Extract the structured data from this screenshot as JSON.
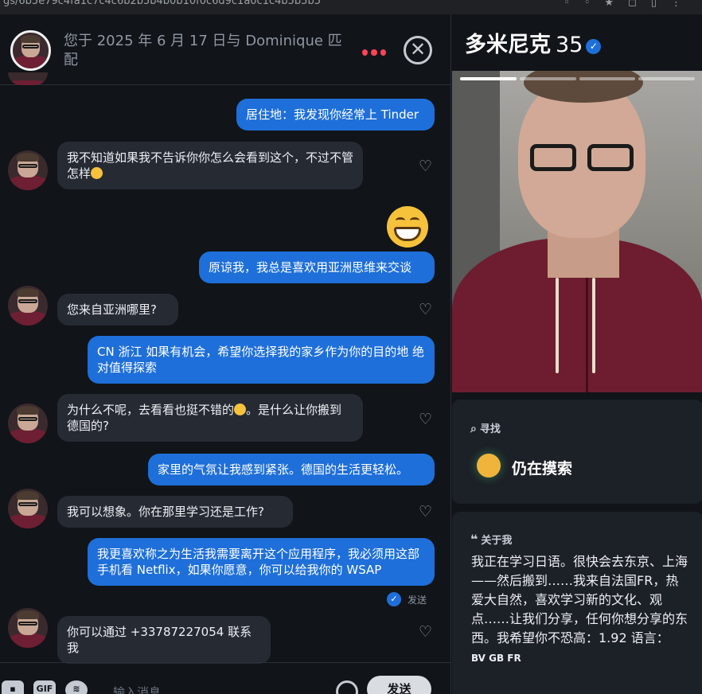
{
  "browser": {
    "url": "gs/6b5e79c4fa1c7c4c6b2b5b4b0b10f0c6d9c1a0c1c4b5b5b5",
    "icons": [
      "cast-icon",
      "translate-icon",
      "star-icon",
      "extensions-icon",
      "profile-icon",
      "menu-icon"
    ]
  },
  "chat": {
    "header": {
      "match_info": "您于 2025 年 6 月 17 日与 Dominique 匹配"
    },
    "messages": [
      {
        "dir": "out",
        "text": "居住地：我发现你经常上 Tinder"
      },
      {
        "dir": "in",
        "text": "我不知道如果我不告诉你你怎么会看到这个，不过不管怎样"
      },
      {
        "dir": "out",
        "text": "原谅我，我总是喜欢用亚洲思维来交谈"
      },
      {
        "dir": "in",
        "text": "您来自亚洲哪里?"
      },
      {
        "dir": "out",
        "text": "CN 浙江 如果有机会，希望你选择我的家乡作为你的目的地 绝对值得探索"
      },
      {
        "dir": "in",
        "text_a": "为什么不呢，去看看也挺不错的",
        "text_b": "。是什么让你搬到德国的?"
      },
      {
        "dir": "out",
        "text": "家里的气氛让我感到紧张。德国的生活更轻松。"
      },
      {
        "dir": "in",
        "text": "我可以想象。你在那里学习还是工作?"
      },
      {
        "dir": "out",
        "text": "我更喜欢称之为生活我需要离开这个应用程序，我必须用这部手机看 Netflix，如果你愿意，你可以给我你的 WSAP"
      },
      {
        "dir": "in",
        "text": "你可以通过 +33787227054 联系我"
      }
    ],
    "sent_status": "发送",
    "composer": {
      "gif_label": "GIF",
      "placeholder": "输入消息",
      "send_label": "发送"
    }
  },
  "profile": {
    "name": "多米尼克",
    "age": "35",
    "verified_mark": "✓",
    "photo_count": 4,
    "photo_active_index": 0,
    "looking": {
      "label": "寻找",
      "value": "仍在摸索"
    },
    "about": {
      "label": "关于我",
      "text": "我正在学习日语。很快会去东京、上海——然后搬到……我来自法国FR，热爱大自然，喜欢学习新的文化、观点……让我们分享，任何你想分享的东西。我希望你不恐高：1.92 语言：",
      "languages": "BV GB FR"
    }
  },
  "colors": {
    "outgoing_bubble": "#1e6fd9",
    "incoming_bubble": "#262a33",
    "accent_dots": "#ff4458"
  }
}
